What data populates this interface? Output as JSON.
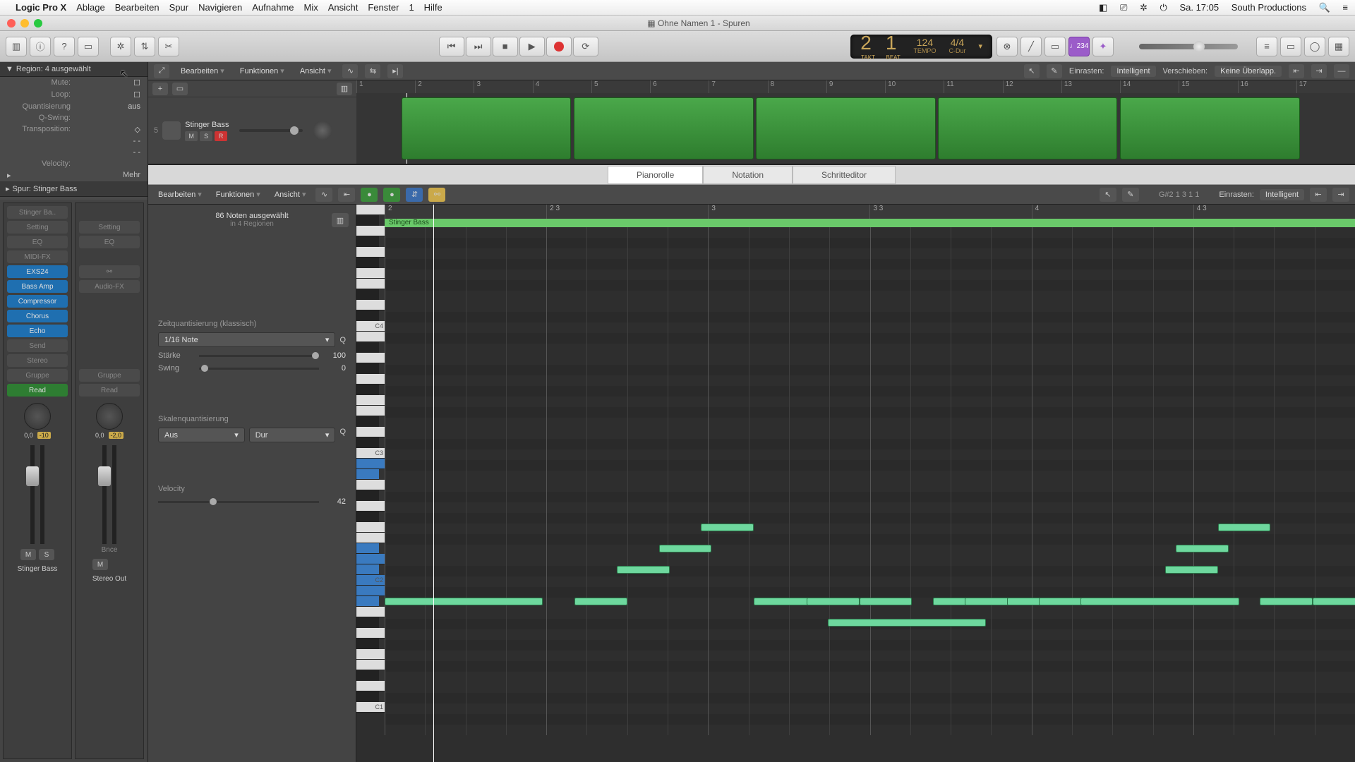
{
  "menubar": {
    "app": "Logic Pro X",
    "items": [
      "Ablage",
      "Bearbeiten",
      "Spur",
      "Navigieren",
      "Aufnahme",
      "Mix",
      "Ansicht",
      "Fenster",
      "1",
      "Hilfe"
    ],
    "clock": "Sa. 17:05",
    "user": "South Productions"
  },
  "window": {
    "title": "Ohne Namen 1 - Spuren"
  },
  "lcd": {
    "bars": "2",
    "beats": "1",
    "bars_label": "TAKT",
    "beats_label": "BEAT",
    "tempo": "124",
    "tempo_label": "TEMPO",
    "sig": "4/4",
    "key": "C-Dur"
  },
  "controlbar": {
    "note_btn": "♩234"
  },
  "track_toolbar": {
    "menus": [
      "Bearbeiten",
      "Funktionen",
      "Ansicht"
    ],
    "snap_label": "Einrasten:",
    "snap_value": "Intelligent",
    "shift_label": "Verschieben:",
    "shift_value": "Keine Überlapp."
  },
  "region_inspector": {
    "title": "Region: 4 ausgewählt",
    "rows": [
      {
        "l": "Mute:",
        "v": ""
      },
      {
        "l": "Loop:",
        "v": ""
      },
      {
        "l": "Quantisierung",
        "v": "aus"
      },
      {
        "l": "Q-Swing:",
        "v": ""
      },
      {
        "l": "Transposition:",
        "v": ""
      },
      {
        "l": "",
        "v": "- -"
      },
      {
        "l": "",
        "v": "- -"
      },
      {
        "l": "Velocity:",
        "v": ""
      }
    ],
    "more": "Mehr",
    "track_title": "Spur: Stinger Bass"
  },
  "strip1": {
    "name": "Stinger Ba..",
    "setting": "Setting",
    "eq": "EQ",
    "midi": "MIDI-FX",
    "inst": "EXS24",
    "fx": [
      "Bass Amp",
      "Compressor",
      "Chorus",
      "Echo"
    ],
    "send": "Send",
    "io": "Stereo",
    "grp": "Gruppe",
    "auto": "Read",
    "pan": "0,0",
    "vol": "-10",
    "m": "M",
    "s": "S",
    "label": "Stinger Bass"
  },
  "strip2": {
    "name": "",
    "setting": "Setting",
    "eq": "EQ",
    "inst": "",
    "fx": "Audio-FX",
    "io": "",
    "grp": "Gruppe",
    "auto": "Read",
    "pan": "0,0",
    "vol": "-2,0",
    "m": "M",
    "bnce": "Bnce",
    "label": "Stereo Out"
  },
  "track": {
    "num": "5",
    "name": "Stinger Bass",
    "m": "M",
    "s": "S",
    "r": "R",
    "ruler": [
      "1",
      "2",
      "3",
      "4",
      "5",
      "6",
      "7",
      "8",
      "9",
      "10",
      "11",
      "12",
      "13",
      "14",
      "15",
      "16",
      "17"
    ]
  },
  "editor_tabs": [
    "Pianorolle",
    "Notation",
    "Schritteditor"
  ],
  "piano_toolbar": {
    "menus": [
      "Bearbeiten",
      "Funktionen",
      "Ansicht"
    ],
    "info": "G#2  1 3 1 1",
    "snap_label": "Einrasten:",
    "snap_value": "Intelligent"
  },
  "piano_left": {
    "head": "86 Noten ausgewählt",
    "sub": "in 4 Regionen",
    "tq_label": "Zeitquantisierung (klassisch)",
    "tq_value": "1/16 Note",
    "strength_l": "Stärke",
    "strength_v": "100",
    "swing_l": "Swing",
    "swing_v": "0",
    "sq_label": "Skalenquantisierung",
    "sq_v1": "Aus",
    "sq_v2": "Dur",
    "vel_label": "Velocity",
    "vel_v": "42"
  },
  "piano_grid": {
    "ruler": [
      "2",
      "2 3",
      "3",
      "3 3",
      "4",
      "4 3"
    ],
    "region_name": "Stinger Bass",
    "key_labels": {
      "C3": "C3",
      "C2": "C2",
      "C1": "C1"
    }
  },
  "chart_data": {
    "type": "table",
    "description": "MIDI notes visible in piano roll (pitch × approximate start in beats × length in 16ths)",
    "notes": [
      {
        "pitch": "C2",
        "start": 1.0,
        "len": 3
      },
      {
        "pitch": "C2",
        "start": 1.9,
        "len": 1
      },
      {
        "pitch": "D#2",
        "start": 2.1,
        "len": 1
      },
      {
        "pitch": "F2",
        "start": 2.3,
        "len": 1
      },
      {
        "pitch": "G2",
        "start": 2.5,
        "len": 1
      },
      {
        "pitch": "C2",
        "start": 2.75,
        "len": 2
      },
      {
        "pitch": "C2",
        "start": 3.0,
        "len": 1
      },
      {
        "pitch": "A#1",
        "start": 3.1,
        "len": 3
      },
      {
        "pitch": "C2",
        "start": 3.25,
        "len": 1
      },
      {
        "pitch": "C2",
        "start": 3.6,
        "len": 1
      },
      {
        "pitch": "C2",
        "start": 3.75,
        "len": 2
      },
      {
        "pitch": "C2",
        "start": 3.95,
        "len": 1
      },
      {
        "pitch": "C2",
        "start": 4.1,
        "len": 1
      },
      {
        "pitch": "C2",
        "start": 4.3,
        "len": 3
      },
      {
        "pitch": "D#2",
        "start": 4.7,
        "len": 1
      },
      {
        "pitch": "F2",
        "start": 4.75,
        "len": 1
      },
      {
        "pitch": "G2",
        "start": 4.95,
        "len": 1
      },
      {
        "pitch": "C2",
        "start": 5.15,
        "len": 1
      },
      {
        "pitch": "C2",
        "start": 5.4,
        "len": 1
      }
    ]
  }
}
